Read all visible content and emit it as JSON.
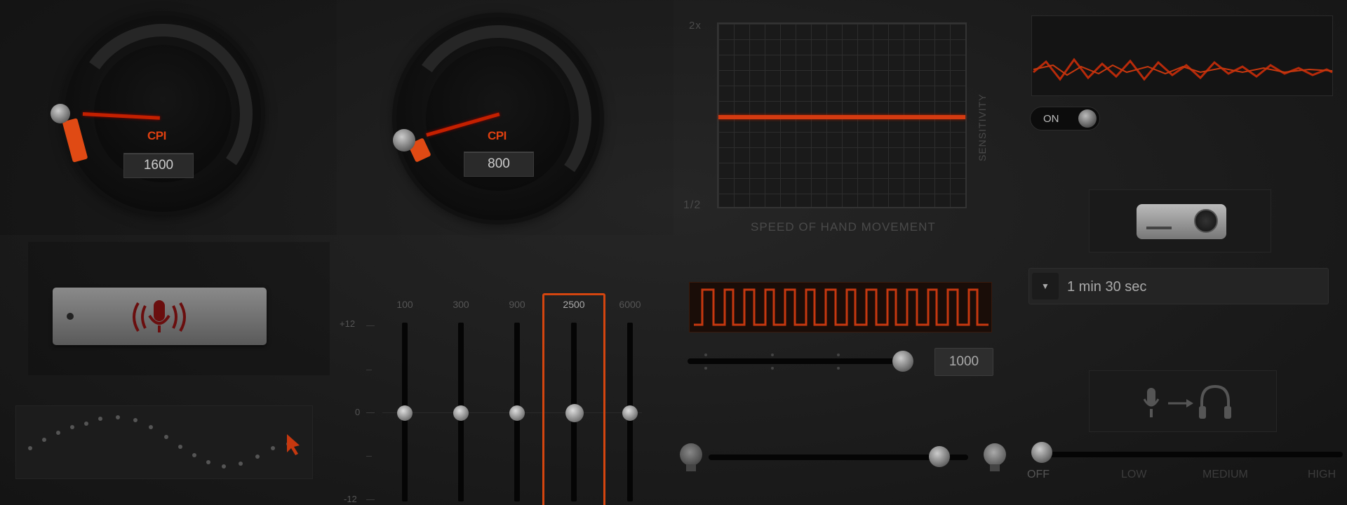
{
  "gauges": [
    {
      "label": "CPI",
      "value": "1600"
    },
    {
      "label": "CPI",
      "value": "800"
    }
  ],
  "sensitivity_chart": {
    "y_top": "2x",
    "y_bottom": "1/2",
    "y_title": "SENSITIVITY",
    "x_title": "SPEED OF HAND MOVEMENT"
  },
  "toggle": {
    "label": "ON"
  },
  "dropdown": {
    "value": "1 min 30 sec"
  },
  "equalizer": {
    "bands": [
      "100",
      "300",
      "900",
      "2500",
      "6000"
    ],
    "scale": {
      "top": "+12",
      "mid": "0",
      "bottom": "-12"
    },
    "selected": "2500"
  },
  "pulse_slider": {
    "value": "1000"
  },
  "level_slider": {
    "labels": [
      "OFF",
      "LOW",
      "MEDIUM",
      "HIGH"
    ]
  },
  "colors": {
    "accent": "#d43a10",
    "background": "#1e1e1e"
  },
  "icons": [
    "microphone-waves-icon",
    "projector-icon",
    "microphone-to-headphones-icon",
    "light-bulb-icon",
    "cursor-icon"
  ]
}
